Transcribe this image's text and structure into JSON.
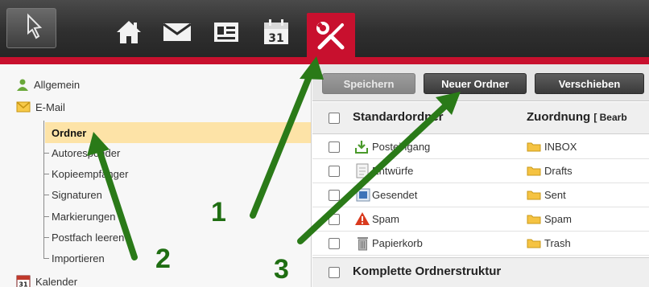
{
  "topbar": {
    "icons": [
      "logo-icon",
      "home-icon",
      "mail-icon",
      "contacts-icon",
      "calendar-icon",
      "settings-icon"
    ],
    "calendar_day": "31",
    "accent": "#c8102e"
  },
  "sidebar": {
    "items": [
      {
        "label": "Allgemein",
        "icon": "user-icon"
      },
      {
        "label": "E-Mail",
        "icon": "mail-icon"
      },
      {
        "label": "Ordner"
      },
      {
        "label": "Autoresponder"
      },
      {
        "label": "Kopieempfänger"
      },
      {
        "label": "Signaturen"
      },
      {
        "label": "Markierungen"
      },
      {
        "label": "Postfach leeren"
      },
      {
        "label": "Importieren"
      },
      {
        "label": "Kalender",
        "icon": "calendar-icon"
      }
    ],
    "calendar_day": "31",
    "selected_color": "#fde3a7"
  },
  "toolbar": {
    "save_label": "Speichern",
    "new_folder_label": "Neuer Ordner",
    "move_label": "Verschieben"
  },
  "table": {
    "header_col1": "Standardordner",
    "header_col2": "Zuordnung",
    "header_col2_extra": "[ Bearb",
    "rows": [
      {
        "name": "Posteingang",
        "mapping": "INBOX",
        "icon": "inbox-icon"
      },
      {
        "name": "Entwürfe",
        "mapping": "Drafts",
        "icon": "drafts-icon"
      },
      {
        "name": "Gesendet",
        "mapping": "Sent",
        "icon": "sent-icon"
      },
      {
        "name": "Spam",
        "mapping": "Spam",
        "icon": "warning-icon"
      },
      {
        "name": "Papierkorb",
        "mapping": "Trash",
        "icon": "trash-icon"
      }
    ],
    "footer_label": "Komplette Ordnerstruktur"
  },
  "annotations": {
    "arrow_color": "#2a7a18",
    "labels": [
      "1",
      "2",
      "3"
    ]
  }
}
